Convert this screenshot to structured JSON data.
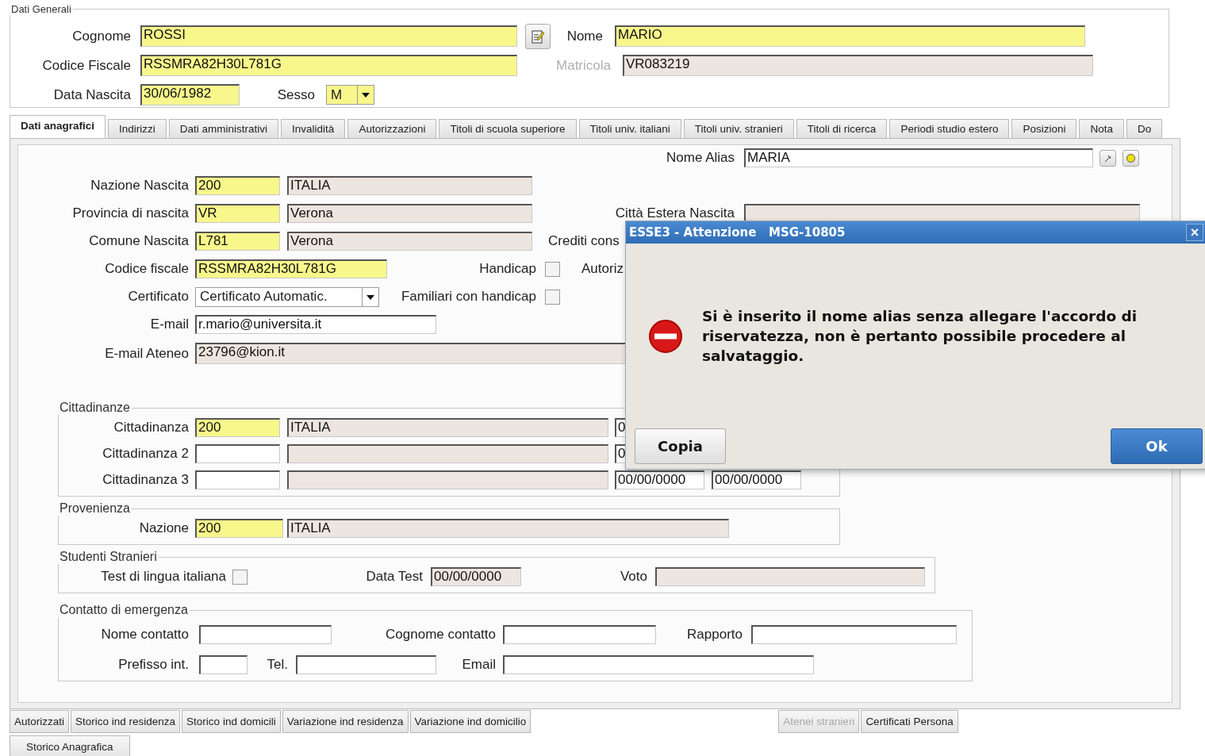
{
  "general": {
    "legend": "Dati Generali",
    "cognome": {
      "label": "Cognome",
      "value": "ROSSI",
      "kind": "required"
    },
    "nome": {
      "label": "Nome",
      "value": "MARIO",
      "kind": "required"
    },
    "codice_fiscale": {
      "label": "Codice Fiscale",
      "value": "RSSMRA82H30L781G",
      "kind": "required"
    },
    "matricola": {
      "label": "Matricola",
      "label_disabled": true,
      "value": "VR083219",
      "kind": "readonly"
    },
    "data_nascita": {
      "label": "Data Nascita",
      "value": "30/06/1982",
      "kind": "required"
    },
    "sesso": {
      "label": "Sesso",
      "value": "M",
      "kind": "required"
    }
  },
  "tabs": [
    {
      "label": "Dati anagrafici",
      "selected": true
    },
    {
      "label": "Indirizzi",
      "selected": false
    },
    {
      "label": "Dati amministrativi",
      "selected": false
    },
    {
      "label": "Invalidità",
      "selected": false
    },
    {
      "label": "Autorizzazioni",
      "selected": false
    },
    {
      "label": "Titoli di scuola superiore",
      "selected": false
    },
    {
      "label": "Titoli univ. italiani",
      "selected": false
    },
    {
      "label": "Titoli univ. stranieri",
      "selected": false
    },
    {
      "label": "Titoli di ricerca",
      "selected": false
    },
    {
      "label": "Periodi studio estero",
      "selected": false
    },
    {
      "label": "Posizioni",
      "selected": false
    },
    {
      "label": "Nota",
      "selected": false
    },
    {
      "label": "Do",
      "selected": false
    }
  ],
  "anagrafici": {
    "nome_alias": {
      "label": "Nome Alias",
      "value": "MARIA",
      "kind": "editable"
    },
    "nazione_nascita": {
      "label": "Nazione Nascita",
      "code": {
        "value": "200",
        "kind": "required"
      },
      "desc": {
        "value": "ITALIA",
        "kind": "readonly"
      }
    },
    "provincia_nascita": {
      "label": "Provincia di nascita",
      "code": {
        "value": "VR",
        "kind": "required"
      },
      "desc": {
        "value": "Verona",
        "kind": "readonly"
      }
    },
    "citta_estera": {
      "label": "Città Estera Nascita",
      "kind": "readonly"
    },
    "comune_nascita": {
      "label": "Comune Nascita",
      "code": {
        "value": "L781",
        "kind": "required"
      },
      "desc": {
        "value": "Verona",
        "kind": "readonly"
      }
    },
    "crediti_label": "Crediti cons",
    "codice_fiscale": {
      "label": "Codice fiscale",
      "value": "RSSMRA82H30L781G",
      "kind": "required"
    },
    "handicap": {
      "label": "Handicap",
      "checked": false
    },
    "autoriz_label": "Autoriz",
    "certificato": {
      "label": "Certificato",
      "value": "Certificato Automatic.",
      "kind": "editable"
    },
    "familiari_handicap": {
      "label": "Familiari con handicap",
      "checked": false
    },
    "email": {
      "label": "E-mail",
      "value": "r.mario@universita.it",
      "kind": "editable"
    },
    "email_ateneo": {
      "label": "E-mail Ateneo",
      "value": "23796@kion.it",
      "kind": "readonly"
    }
  },
  "cittadinanze": {
    "legend": "Cittadinanze",
    "rows": [
      {
        "label": "Cittadinanza",
        "code": {
          "value": "200",
          "kind": "required"
        },
        "desc": {
          "value": "ITALIA",
          "kind": "readonly"
        },
        "date_1": {
          "value": "0",
          "kind": "editable"
        },
        "date_2": null
      },
      {
        "label": "Cittadinanza 2",
        "code": {
          "kind": "editable"
        },
        "desc": {
          "kind": "readonly"
        },
        "date_1": {
          "value": "0",
          "kind": "editable"
        },
        "date_2": null
      },
      {
        "label": "Cittadinanza 3",
        "code": {
          "kind": "editable"
        },
        "desc": {
          "kind": "readonly"
        },
        "date_1": {
          "value": "00/00/0000",
          "kind": "editable"
        },
        "date_2": {
          "value": "00/00/0000",
          "kind": "editable"
        }
      }
    ]
  },
  "provenienza": {
    "legend": "Provenienza",
    "label": "Nazione",
    "code": {
      "value": "200",
      "kind": "required"
    },
    "desc": {
      "value": "ITALIA",
      "kind": "readonly"
    }
  },
  "studenti_stranieri": {
    "legend": "Studenti Stranieri",
    "test_lingua": {
      "label": "Test di lingua italiana",
      "checked": false
    },
    "data_test": {
      "label": "Data Test",
      "value": "00/00/0000",
      "kind": "readonly"
    },
    "voto": {
      "label": "Voto",
      "kind": "readonly"
    }
  },
  "contatto_emergenza": {
    "legend": "Contatto di emergenza",
    "nome": {
      "label": "Nome contatto",
      "kind": "editable"
    },
    "cognome": {
      "label": "Cognome contatto",
      "kind": "editable"
    },
    "rapporto": {
      "label": "Rapporto",
      "kind": "editable"
    },
    "prefisso": {
      "label": "Prefisso int.",
      "kind": "editable"
    },
    "tel": {
      "label": "Tel.",
      "kind": "editable"
    },
    "email": {
      "label": "Email",
      "kind": "editable"
    }
  },
  "bottom_buttons": [
    {
      "label": "Autorizzati",
      "disabled": false
    },
    {
      "label": "Storico ind residenza",
      "disabled": false
    },
    {
      "label": "Storico ind domicili",
      "disabled": false
    },
    {
      "label": "Variazione ind residenza",
      "disabled": false
    },
    {
      "label": "Variazione ind domicilio",
      "disabled": false
    },
    {
      "label": "Atenei stranieri",
      "disabled": true
    },
    {
      "label": "Certificati Persona",
      "disabled": false
    }
  ],
  "bottom_buttons_2": [
    "Storico Anagrafica"
  ],
  "dialog": {
    "title": "ESSE3 - Attenzione   MSG-10805",
    "close": "×",
    "message": "Si è inserito il nome alias senza allegare l'accordo di riservatezza, non è pertanto possibile procedere al salvataggio.",
    "buttons": [
      {
        "label": "Copia",
        "primary": false
      },
      {
        "label": "Ok",
        "primary": true
      }
    ]
  }
}
